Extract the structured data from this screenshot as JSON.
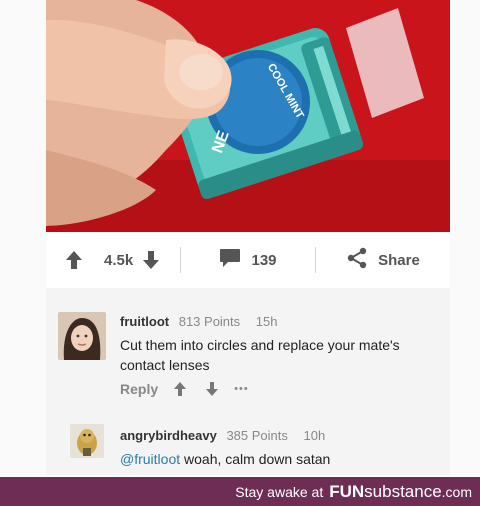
{
  "post": {
    "image_alt": "Hand holding a Cool Mint dental floss container",
    "floss_label": "COOL MINT",
    "floss_brand_fragment": "NE"
  },
  "action_bar": {
    "upvotes": "4.5k",
    "comments": "139",
    "share_label": "Share",
    "upvote_icon": "arrow-up-icon",
    "downvote_icon": "arrow-down-icon",
    "comment_icon": "comment-bubble-icon",
    "share_icon": "share-nodes-icon"
  },
  "comments": [
    {
      "username": "fruitloot",
      "points": "813 Points",
      "time": "15h",
      "text": "Cut them into circles and replace your mate's contact lenses",
      "reply_label": "Reply",
      "more": "•••"
    },
    {
      "username": "angrybirdheavy",
      "points": "385 Points",
      "time": "10h",
      "mention": "@fruitloot",
      "text": " woah, calm down satan"
    }
  ],
  "footer": {
    "tagline": "Stay awake at",
    "brand_prefix": "FUN",
    "brand_suffix": "substance",
    "domain": ".com"
  },
  "colors": {
    "photo_background": "#c8141a",
    "floss_case": "#3fb8b0",
    "footer_background": "#6e2d55",
    "mention": "#2a7ab0"
  }
}
